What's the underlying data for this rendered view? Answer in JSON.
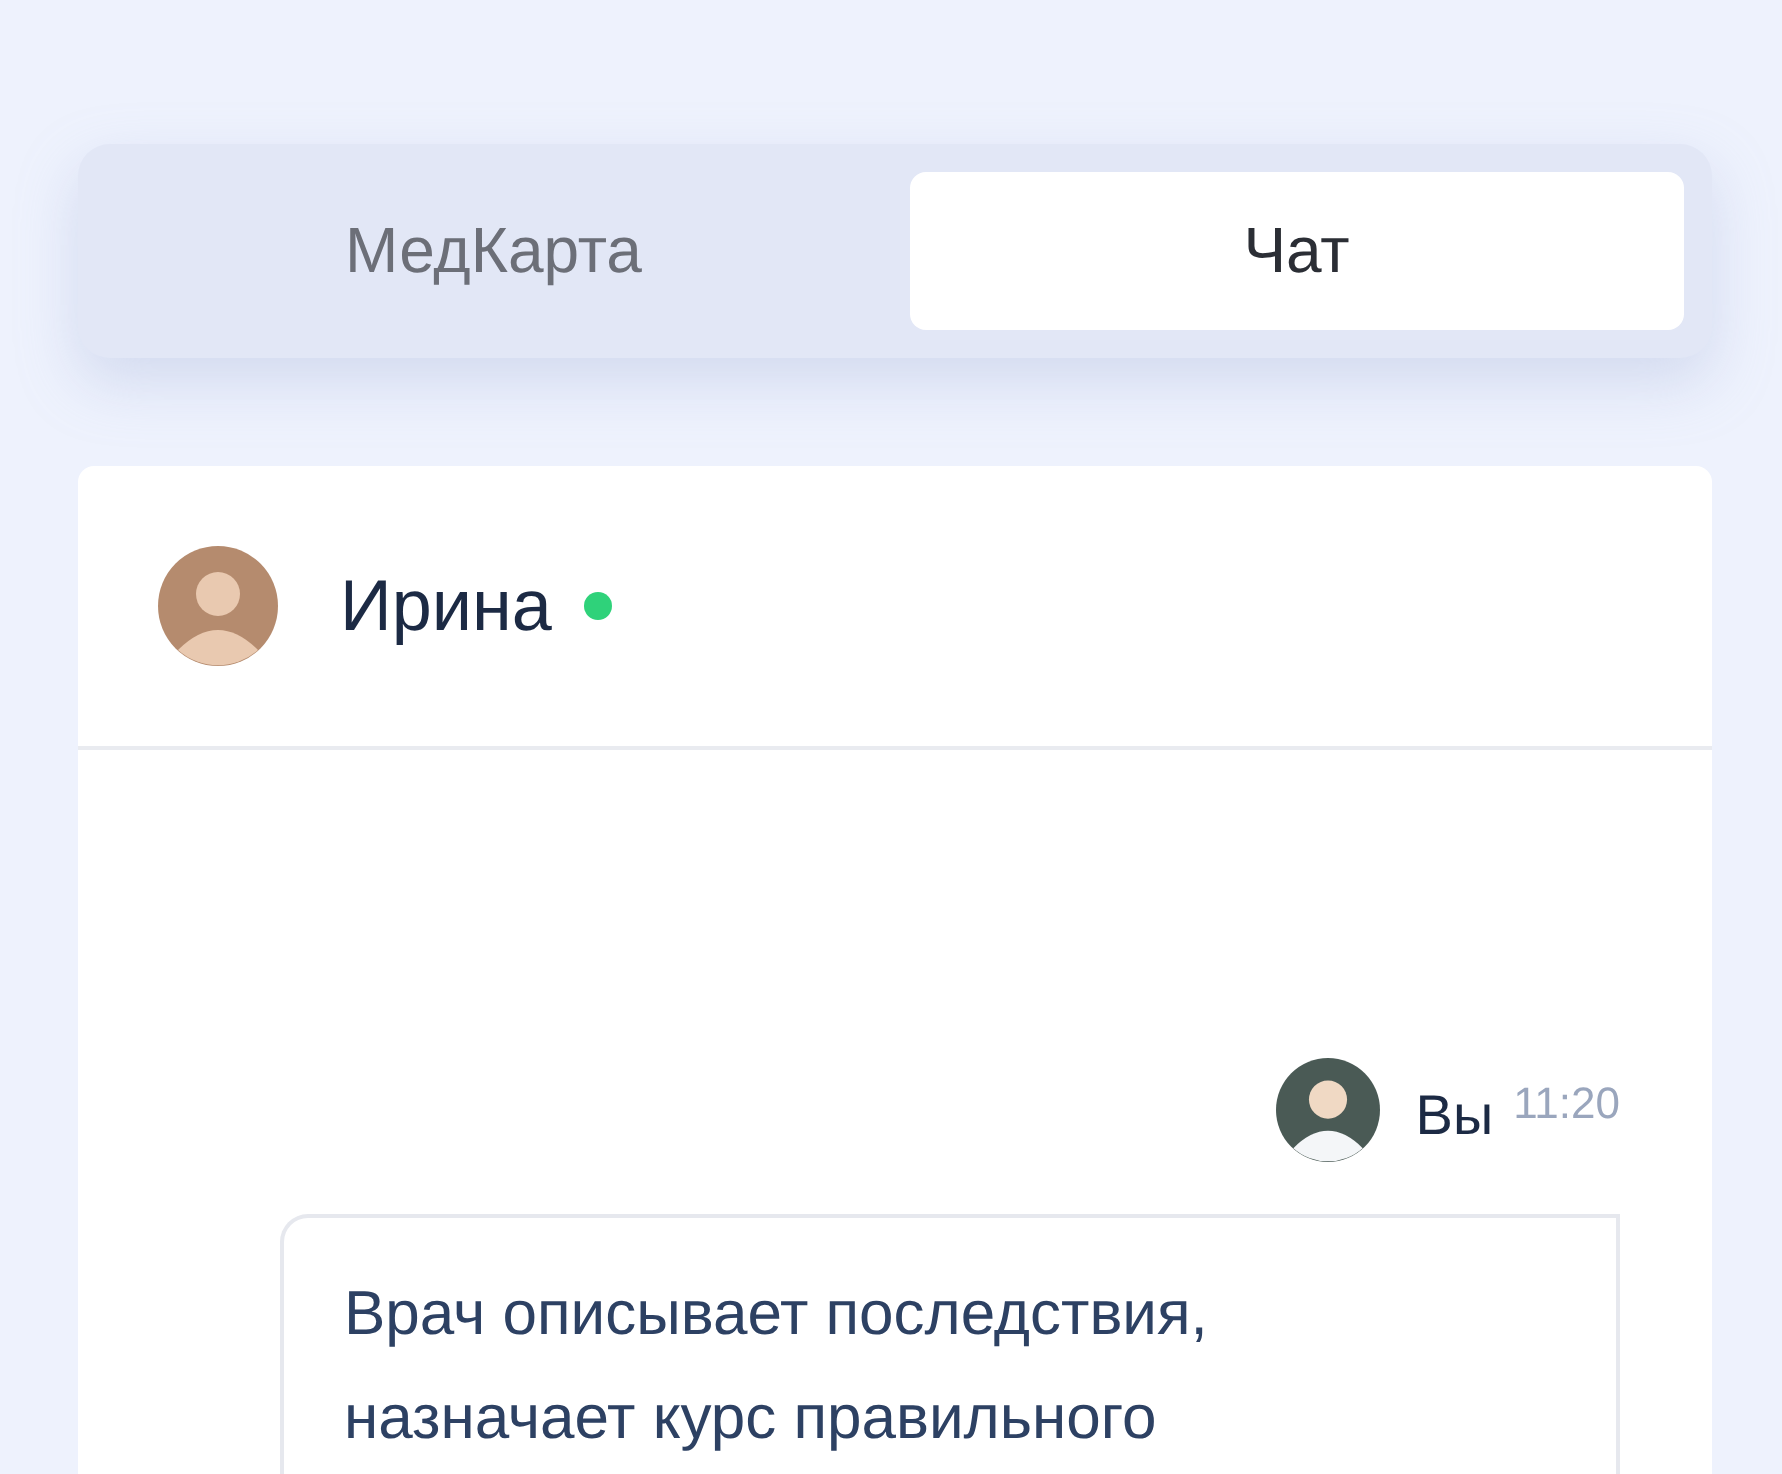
{
  "tabs": [
    {
      "label": "МедКарта",
      "selected": false
    },
    {
      "label": "Чат",
      "selected": true
    }
  ],
  "chat": {
    "contact": {
      "name": "Ирина",
      "online": true
    },
    "messages": [
      {
        "author": "Вы",
        "time": "11:20",
        "text": "Врач описывает последствия, назначает курс правильного"
      }
    ]
  }
}
